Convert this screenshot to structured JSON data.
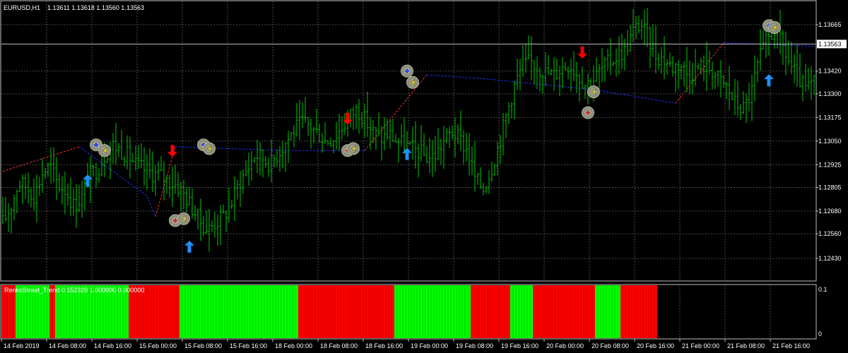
{
  "header": {
    "symbol_label": "EURUSD,H1",
    "ohlc_label": "1.13611 1.13618 1.13560 1.13563"
  },
  "indicator": {
    "label": "RenkoStreet_Trend 0.152329 1.000000 0.000000",
    "scale_top": "0.1",
    "scale_bottom": "0"
  },
  "colors": {
    "background": "#000000",
    "grid": "#4a4a4a",
    "axis": "#c0c0c0",
    "candle": "#00c800",
    "bull_bar": "#00ff00",
    "bear_bar": "#ff0000",
    "trend_up_line": "#ff3030",
    "trend_down_line": "#2030ff",
    "buy_arrow": "#1e90ff",
    "sell_arrow": "#ff0000",
    "current_price_line": "#c0c0c0"
  },
  "chart_data": {
    "type": "candlestick",
    "symbol": "EURUSD",
    "timeframe": "H1",
    "current_price": "1.13563",
    "y_tick_labels": [
      "1.13665",
      "1.13420",
      "1.13300",
      "1.13175",
      "1.13050",
      "1.12925",
      "1.12805",
      "1.12680",
      "1.12560",
      "1.12430"
    ],
    "y_tick_values": [
      1.13665,
      1.1342,
      1.133,
      1.13175,
      1.1305,
      1.12925,
      1.12805,
      1.1268,
      1.1256,
      1.1243
    ],
    "x_tick_labels": [
      "14 Feb 2019",
      "14 Feb 08:00",
      "14 Feb 16:00",
      "15 Feb 00:00",
      "15 Feb 08:00",
      "15 Feb 16:00",
      "18 Feb 00:00",
      "18 Feb 08:00",
      "18 Feb 16:00",
      "19 Feb 00:00",
      "19 Feb 08:00",
      "19 Feb 16:00",
      "20 Feb 00:00",
      "20 Feb 08:00",
      "20 Feb 16:00",
      "21 Feb 00:00",
      "21 Feb 08:00",
      "21 Feb 16:00"
    ],
    "closes": [
      1.1262,
      1.127,
      1.1283,
      1.1281,
      1.1276,
      1.1288,
      1.1292,
      1.1282,
      1.1279,
      1.1271,
      1.1275,
      1.1287,
      1.129,
      1.1298,
      1.1303,
      1.13,
      1.1297,
      1.1292,
      1.129,
      1.1288,
      1.1287,
      1.1284,
      1.1282,
      1.1277,
      1.127,
      1.1263,
      1.1258,
      1.1262,
      1.1265,
      1.1272,
      1.1283,
      1.129,
      1.1298,
      1.1296,
      1.1293,
      1.1299,
      1.1305,
      1.1311,
      1.1315,
      1.1313,
      1.1309,
      1.1305,
      1.1307,
      1.1312,
      1.1318,
      1.1322,
      1.1316,
      1.131,
      1.1306,
      1.1309,
      1.1305,
      1.1303,
      1.1301,
      1.1299,
      1.1296,
      1.1298,
      1.1305,
      1.131,
      1.1306,
      1.13,
      1.1285,
      1.128,
      1.129,
      1.1304,
      1.132,
      1.1335,
      1.1345,
      1.1347,
      1.1344,
      1.1341,
      1.134,
      1.1344,
      1.1346,
      1.134,
      1.1335,
      1.1338,
      1.1343,
      1.1347,
      1.135,
      1.1353,
      1.1363,
      1.1367,
      1.1359,
      1.135,
      1.1348,
      1.1344,
      1.1346,
      1.134,
      1.1343,
      1.1345,
      1.1343,
      1.1337,
      1.1333,
      1.1325,
      1.1322,
      1.133,
      1.1348,
      1.1358,
      1.1364,
      1.1355,
      1.1345,
      1.1338,
      1.1332,
      1.1336
    ],
    "renko_segments": [
      {
        "trend": "up",
        "points": [
          [
            0,
            1.1289
          ],
          [
            27,
            1.1302
          ]
        ]
      },
      {
        "trend": "down",
        "points": [
          [
            27,
            1.1302
          ],
          [
            51,
            1.1276
          ],
          [
            54,
            1.1265
          ]
        ]
      },
      {
        "trend": "up",
        "points": [
          [
            54,
            1.1265
          ],
          [
            61,
            1.1302
          ]
        ]
      },
      {
        "trend": "down",
        "points": [
          [
            61,
            1.1302
          ],
          [
            100,
            1.13
          ],
          [
            128,
            1.13
          ]
        ]
      },
      {
        "trend": "up",
        "points": [
          [
            128,
            1.13
          ],
          [
            150,
            1.134
          ]
        ]
      },
      {
        "trend": "down",
        "points": [
          [
            150,
            1.134
          ],
          [
            170,
            1.1338
          ],
          [
            210,
            1.1332
          ],
          [
            238,
            1.1325
          ]
        ]
      },
      {
        "trend": "up",
        "points": [
          [
            238,
            1.1325
          ],
          [
            255,
            1.1357
          ]
        ]
      },
      {
        "trend": "down",
        "points": [
          [
            255,
            1.1357
          ],
          [
            288,
            1.1355
          ]
        ]
      }
    ],
    "buy_arrows": [
      {
        "bar": 30,
        "price": 1.1284
      },
      {
        "bar": 66,
        "price": 1.1249
      },
      {
        "bar": 143,
        "price": 1.1298
      },
      {
        "bar": 271,
        "price": 1.1337
      }
    ],
    "sell_arrows": [
      {
        "bar": 60,
        "price": 1.13
      },
      {
        "bar": 122,
        "price": 1.1317
      },
      {
        "bar": 205,
        "price": 1.1352
      }
    ],
    "trade_markers": [
      {
        "bar": 33,
        "price": 1.1303,
        "kind": "buy-open"
      },
      {
        "bar": 36,
        "price": 1.13,
        "kind": "close"
      },
      {
        "bar": 61,
        "price": 1.1263,
        "kind": "sell-open"
      },
      {
        "bar": 64,
        "price": 1.1264,
        "kind": "close"
      },
      {
        "bar": 71,
        "price": 1.1303,
        "kind": "buy-open"
      },
      {
        "bar": 73,
        "price": 1.1301,
        "kind": "close"
      },
      {
        "bar": 122,
        "price": 1.13,
        "kind": "sell-open"
      },
      {
        "bar": 124,
        "price": 1.1301,
        "kind": "close"
      },
      {
        "bar": 143,
        "price": 1.1342,
        "kind": "buy-open"
      },
      {
        "bar": 145,
        "price": 1.1336,
        "kind": "close"
      },
      {
        "bar": 207,
        "price": 1.132,
        "kind": "sell-open"
      },
      {
        "bar": 209,
        "price": 1.1331,
        "kind": "close"
      },
      {
        "bar": 271,
        "price": 1.1366,
        "kind": "buy-open"
      },
      {
        "bar": 273,
        "price": 1.1365,
        "kind": "close"
      }
    ],
    "trend_blocks": [
      {
        "state": "bear",
        "bars": 5
      },
      {
        "state": "bull",
        "bars": 12
      },
      {
        "state": "bear",
        "bars": 2
      },
      {
        "state": "bull",
        "bars": 26
      },
      {
        "state": "bear",
        "bars": 18
      },
      {
        "state": "bull",
        "bars": 42
      },
      {
        "state": "bear",
        "bars": 34
      },
      {
        "state": "bull",
        "bars": 27
      },
      {
        "state": "bear",
        "bars": 14
      },
      {
        "state": "bull",
        "bars": 8
      },
      {
        "state": "bear",
        "bars": 22
      },
      {
        "state": "bull",
        "bars": 9
      },
      {
        "state": "bear",
        "bars": 13
      }
    ]
  }
}
